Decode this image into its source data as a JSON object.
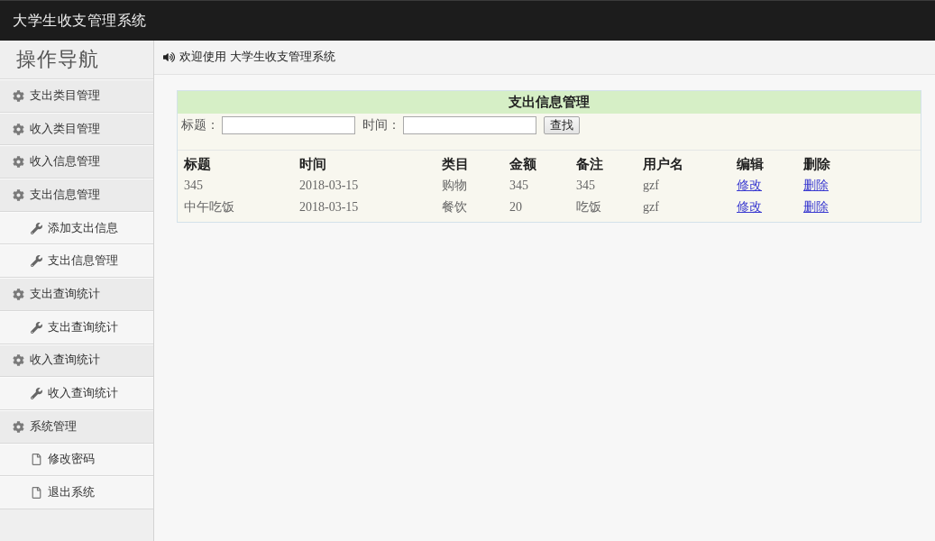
{
  "header": {
    "title": "大学生收支管理系统"
  },
  "sidebar": {
    "title": "操作导航",
    "items": [
      {
        "label": "支出类目管理"
      },
      {
        "label": "收入类目管理"
      },
      {
        "label": "收入信息管理"
      },
      {
        "label": "支出信息管理",
        "children": [
          {
            "label": "添加支出信息",
            "kind": "tool"
          },
          {
            "label": "支出信息管理",
            "kind": "tool"
          }
        ]
      },
      {
        "label": "支出查询统计",
        "children": [
          {
            "label": "支出查询统计",
            "kind": "tool"
          }
        ]
      },
      {
        "label": "收入查询统计",
        "children": [
          {
            "label": "收入查询统计",
            "kind": "tool"
          }
        ]
      },
      {
        "label": "系统管理",
        "children": [
          {
            "label": "修改密码",
            "kind": "page"
          },
          {
            "label": "退出系统",
            "kind": "page"
          }
        ]
      }
    ]
  },
  "breadcrumb": {
    "text": "欢迎使用 大学生收支管理系统"
  },
  "panel": {
    "title": "支出信息管理",
    "search": {
      "fields": [
        {
          "label": "标题："
        },
        {
          "label": "时间："
        }
      ],
      "button": "查找"
    },
    "table": {
      "columns": [
        "标题",
        "时间",
        "类目",
        "金额",
        "备注",
        "用户名",
        "编辑",
        "删除"
      ],
      "rows": [
        {
          "cells": [
            {
              "kind": "text",
              "text": "345"
            },
            {
              "kind": "text",
              "text": "2018-03-15"
            },
            {
              "kind": "text",
              "text": "购物"
            },
            {
              "kind": "text",
              "text": "345"
            },
            {
              "kind": "text",
              "text": "345"
            },
            {
              "kind": "text",
              "text": "gzf"
            },
            {
              "kind": "link",
              "text": "修改"
            },
            {
              "kind": "link",
              "text": "删除"
            }
          ]
        },
        {
          "cells": [
            {
              "kind": "text",
              "text": "中午吃饭"
            },
            {
              "kind": "text",
              "text": "2018-03-15"
            },
            {
              "kind": "text",
              "text": "餐饮"
            },
            {
              "kind": "text",
              "text": "20"
            },
            {
              "kind": "text",
              "text": "吃饭"
            },
            {
              "kind": "text",
              "text": "gzf"
            },
            {
              "kind": "link",
              "text": "修改"
            },
            {
              "kind": "link",
              "text": "删除"
            }
          ]
        }
      ]
    }
  }
}
